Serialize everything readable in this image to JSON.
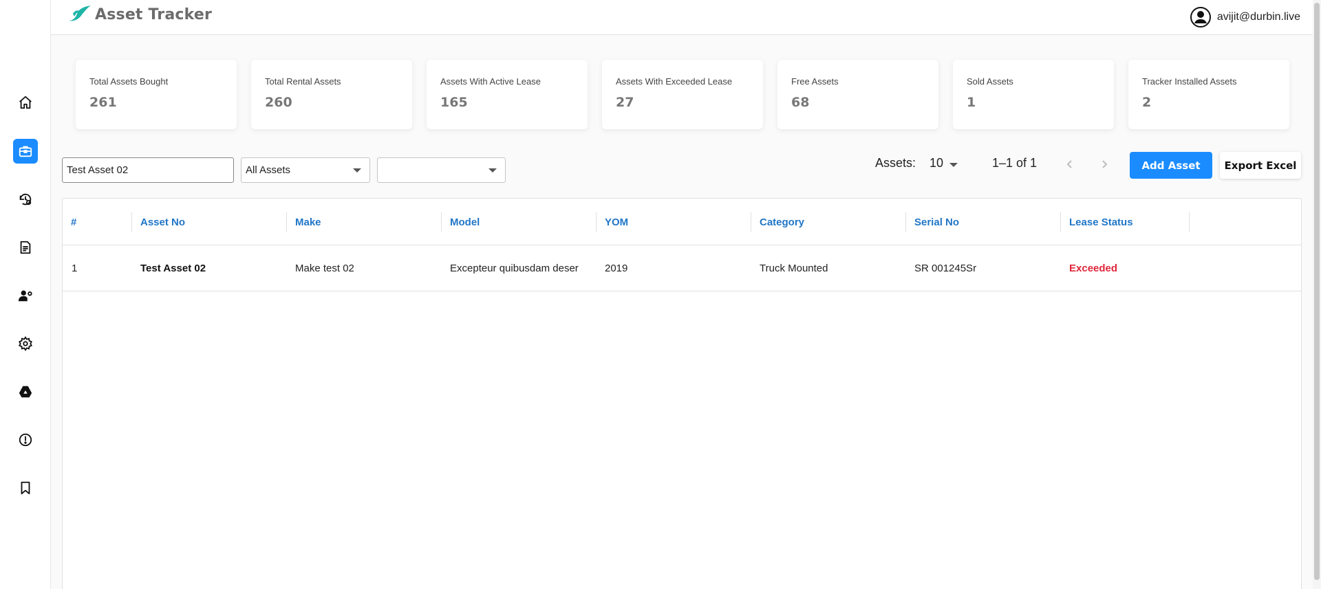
{
  "app": {
    "title": "Asset Tracker",
    "brand_color": "#1a8cff",
    "logo_color": "#1fb5a8"
  },
  "user": {
    "email": "avijit@durbin.live",
    "icon": "user-circle-icon"
  },
  "sidebar": {
    "items": [
      {
        "name": "home",
        "icon": "home-icon",
        "active": false
      },
      {
        "name": "assets",
        "icon": "briefcase-icon",
        "active": true
      },
      {
        "name": "lease-history",
        "icon": "history-gear-icon",
        "active": false
      },
      {
        "name": "documents",
        "icon": "document-icon",
        "active": false
      },
      {
        "name": "customers",
        "icon": "user-settings-icon",
        "active": false
      },
      {
        "name": "settings",
        "icon": "gear-icon",
        "active": false
      },
      {
        "name": "drive",
        "icon": "drive-icon",
        "active": false
      },
      {
        "name": "alerts",
        "icon": "alert-circle-icon",
        "active": false
      },
      {
        "name": "bookmarks",
        "icon": "bookmark-icon",
        "active": false
      }
    ]
  },
  "stats": [
    {
      "label": "Total Assets Bought",
      "value": "261"
    },
    {
      "label": "Total Rental Assets",
      "value": "260"
    },
    {
      "label": "Assets With Active Lease",
      "value": "165"
    },
    {
      "label": "Assets With Exceeded Lease",
      "value": "27"
    },
    {
      "label": "Free Assets",
      "value": "68"
    },
    {
      "label": "Sold Assets",
      "value": "1"
    },
    {
      "label": "Tracker Installed Assets",
      "value": "2"
    }
  ],
  "filters": {
    "search_value": "Test Asset 02",
    "asset_type": "All Assets",
    "category": ""
  },
  "pagination": {
    "label": "Assets:",
    "page_size": "10",
    "range": "1–1 of 1"
  },
  "actions": {
    "add": "Add Asset",
    "export": "Export Excel"
  },
  "table": {
    "columns": [
      "#",
      "Asset No",
      "Make",
      "Model",
      "YOM",
      "Category",
      "Serial No",
      "Lease Status"
    ],
    "rows": [
      [
        "1",
        "Test Asset 02",
        "Make test 02",
        "Excepteur quibusdam deser",
        "2019",
        "Truck Mounted",
        "SR 001245Sr",
        "Exceeded"
      ]
    ],
    "status_color_exceeded": "#e0263a",
    "header_color": "#2176c7"
  }
}
